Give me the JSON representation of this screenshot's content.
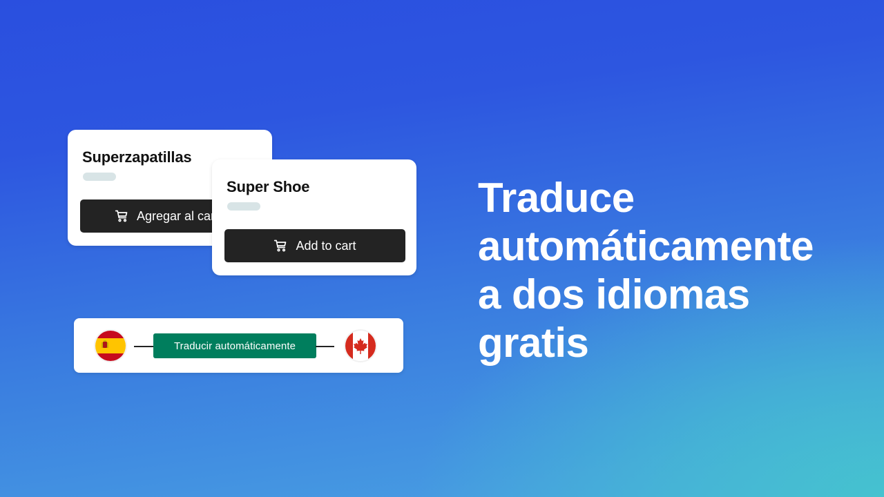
{
  "cards": {
    "spanish": {
      "title": "Superzapatillas",
      "button_label": "Agregar al carrito",
      "button_icon": "cart-icon"
    },
    "english": {
      "title": "Super Shoe",
      "button_label": "Add to cart",
      "button_icon": "cart-icon"
    }
  },
  "translate_bar": {
    "source_flag": "spain-flag-icon",
    "target_flag": "canada-flag-icon",
    "button_label": "Traducir automáticamente",
    "button_color": "#007e5d"
  },
  "headline": {
    "lines": [
      "Traduce",
      "automáticamente",
      "a dos idiomas",
      "gratis"
    ]
  },
  "colors": {
    "background_top": "#2a4fdf",
    "background_bottom_right": "#45c2cf",
    "button_dark": "#232323",
    "placeholder": "#d8e4e6"
  }
}
